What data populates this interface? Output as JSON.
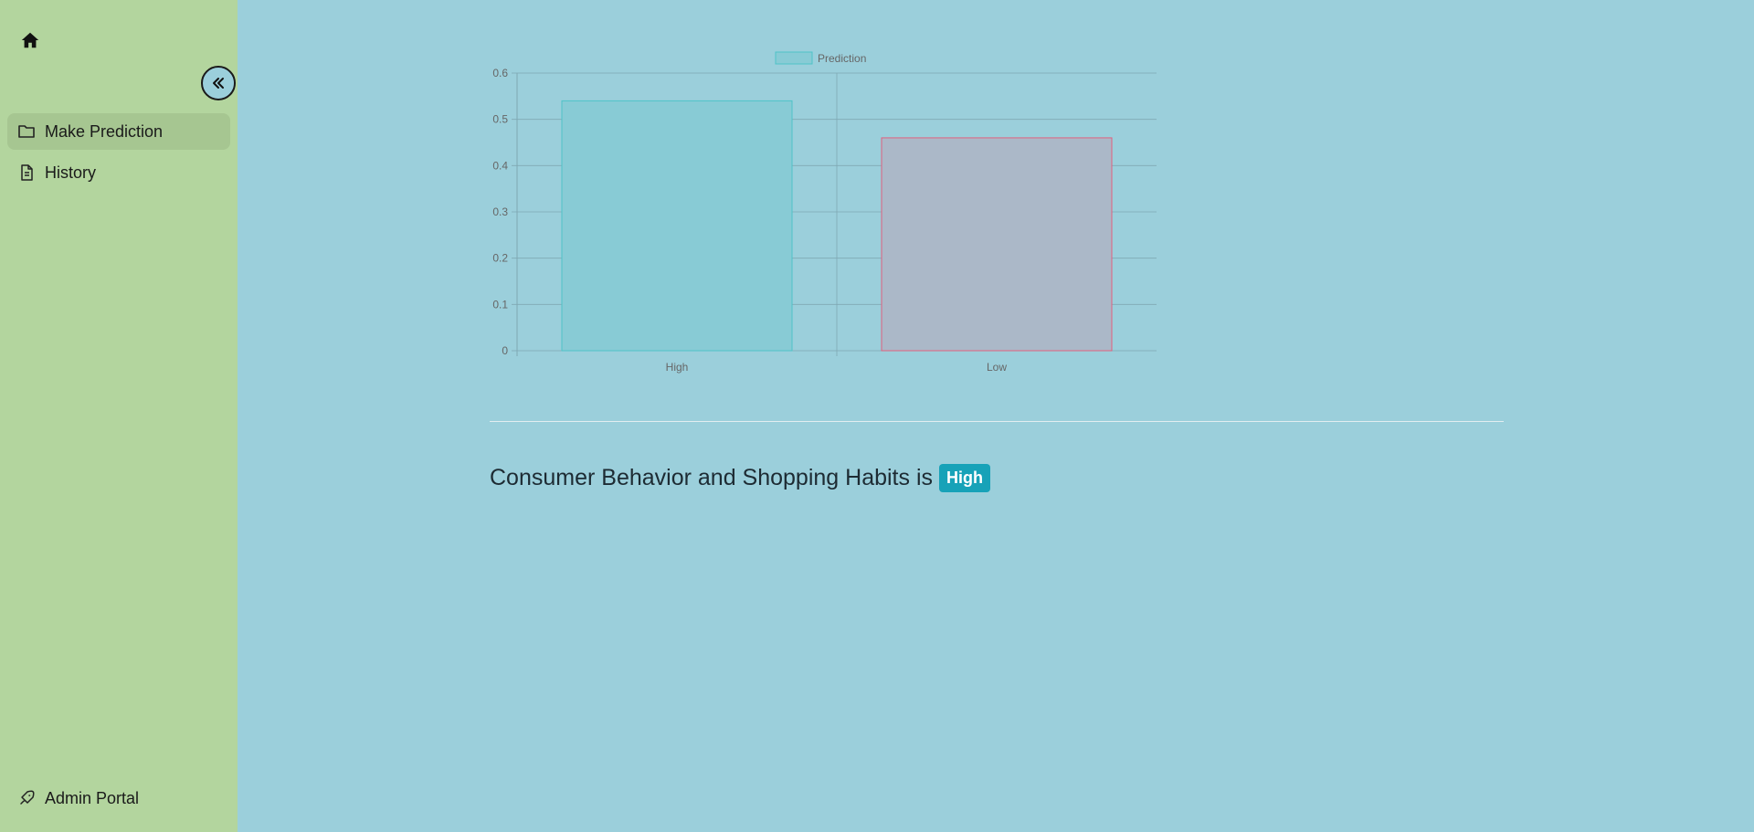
{
  "sidebar": {
    "home_icon": "home-icon",
    "collapse_icon": "chevrons-left-icon",
    "items": [
      {
        "label": "Make Prediction",
        "icon": "folder-icon",
        "active": true
      },
      {
        "label": "History",
        "icon": "document-icon",
        "active": false
      }
    ],
    "footer_item": {
      "label": "Admin Portal",
      "icon": "rocket-icon"
    }
  },
  "colors": {
    "sidebar_bg": "#b3d59e",
    "main_bg": "#9bcfdb",
    "high_fill": "#88cbd5",
    "high_border": "#4fc3c8",
    "low_fill": "#abb8c8",
    "low_border": "#e0607e",
    "badge": "#17a2b8"
  },
  "chart_data": {
    "type": "bar",
    "categories": [
      "High",
      "Low"
    ],
    "series": [
      {
        "name": "Prediction",
        "values": [
          0.54,
          0.46
        ]
      }
    ],
    "ylim": [
      0,
      0.6
    ],
    "yticks": [
      "0",
      "0.1",
      "0.2",
      "0.3",
      "0.4",
      "0.5",
      "0.6"
    ],
    "legend": "top-center",
    "grid": true
  },
  "result": {
    "text": "Consumer Behavior and Shopping Habits is",
    "badge": "High"
  }
}
